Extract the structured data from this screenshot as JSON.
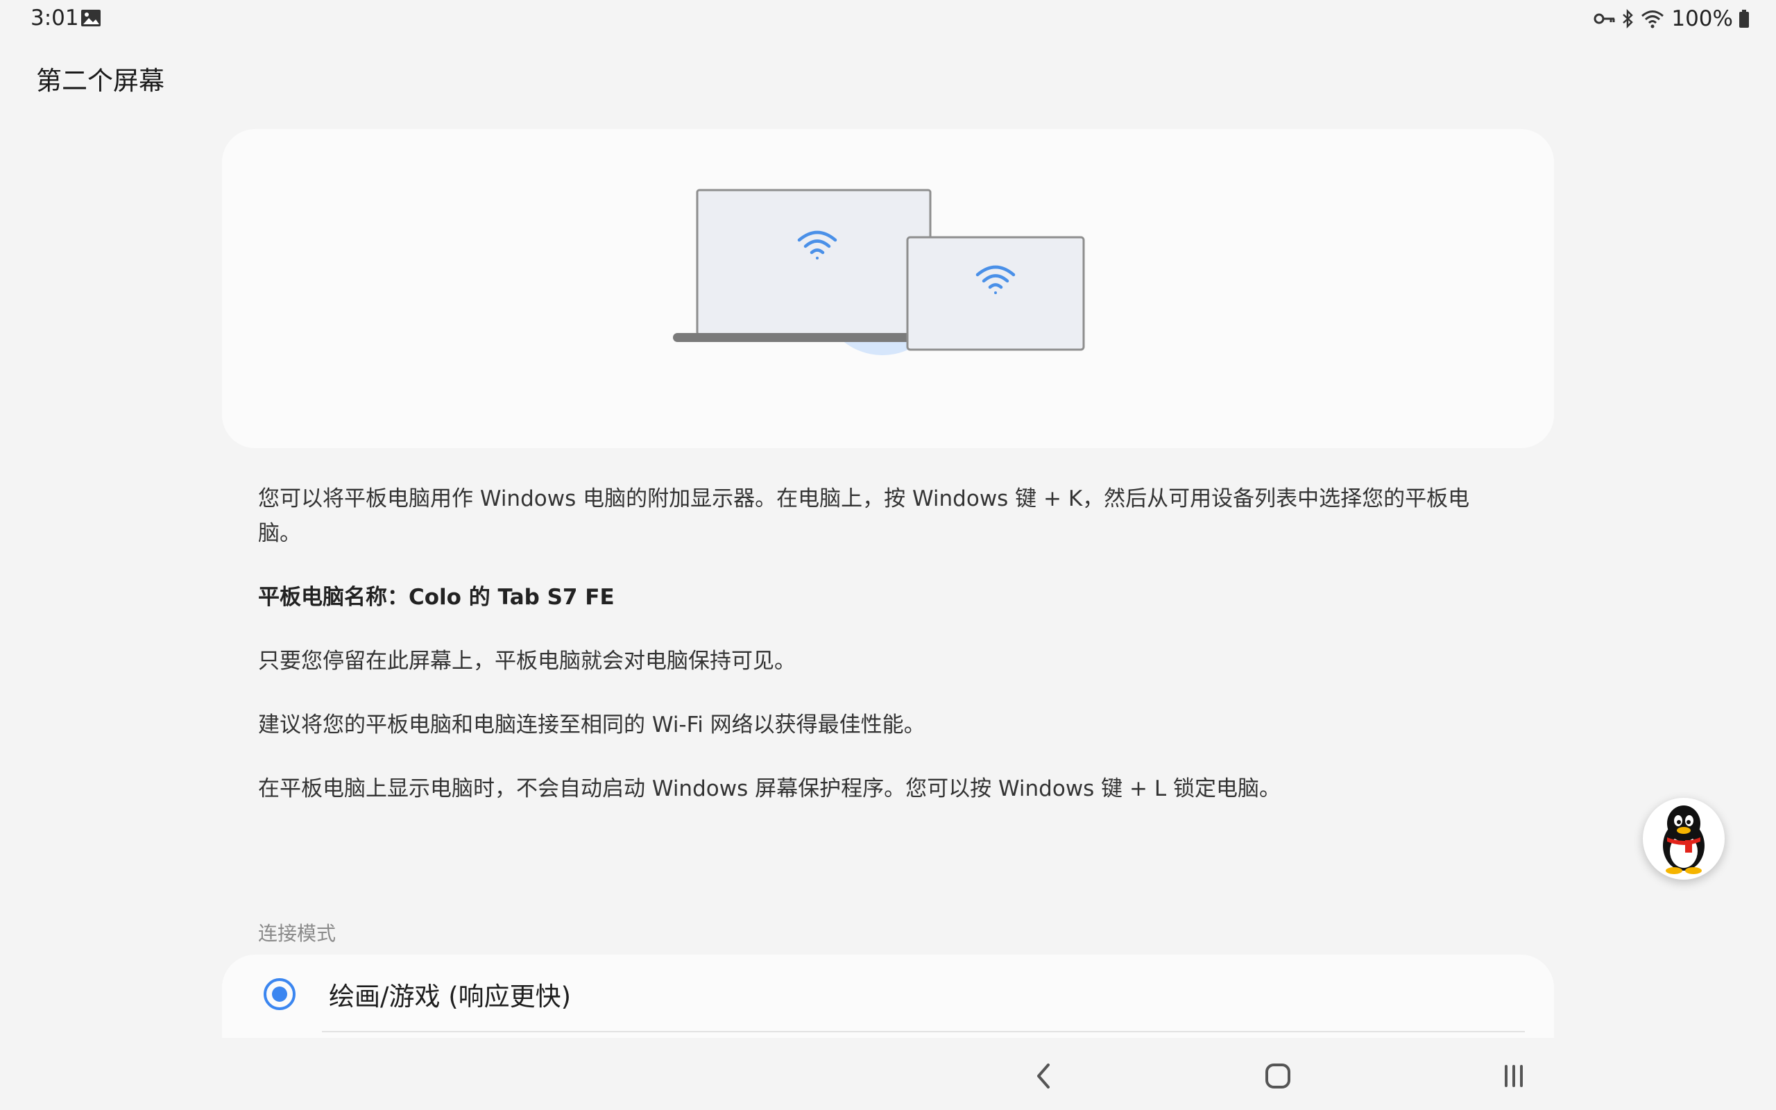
{
  "status_bar": {
    "time": "3:01",
    "battery": "100%",
    "icons": [
      "gallery-icon",
      "key-icon",
      "bluetooth-icon",
      "wifi-icon",
      "battery-icon"
    ]
  },
  "page": {
    "title": "第二个屏幕"
  },
  "hero": {
    "illustration": "laptop-and-tablet-wifi-illustration",
    "accent_color": "#4a90e8"
  },
  "description": {
    "intro": "您可以将平板电脑用作 Windows 电脑的附加显示器。在电脑上，按 Windows 键 + K，然后从可用设备列表中选择您的平板电脑。",
    "tablet_name": "平板电脑名称：Colo 的 Tab S7 FE",
    "visibility": "只要您停留在此屏幕上，平板电脑就会对电脑保持可见。",
    "network_tip": "建议将您的平板电脑和电脑连接至相同的 Wi-Fi 网络以获得最佳性能。",
    "screensaver_tip": "在平板电脑上显示电脑时，不会自动启动 Windows 屏幕保护程序。您可以按 Windows 键 + L 锁定电脑。"
  },
  "connection_mode": {
    "label": "连接模式",
    "options": [
      {
        "label": "绘画/游戏 (响应更快)",
        "selected": true
      }
    ],
    "accent_color": "#3b86f0"
  },
  "nav_bar": {
    "buttons": [
      "back-icon",
      "home-icon",
      "recents-icon"
    ]
  },
  "floating_bubble": {
    "icon": "qq-penguin-icon"
  }
}
